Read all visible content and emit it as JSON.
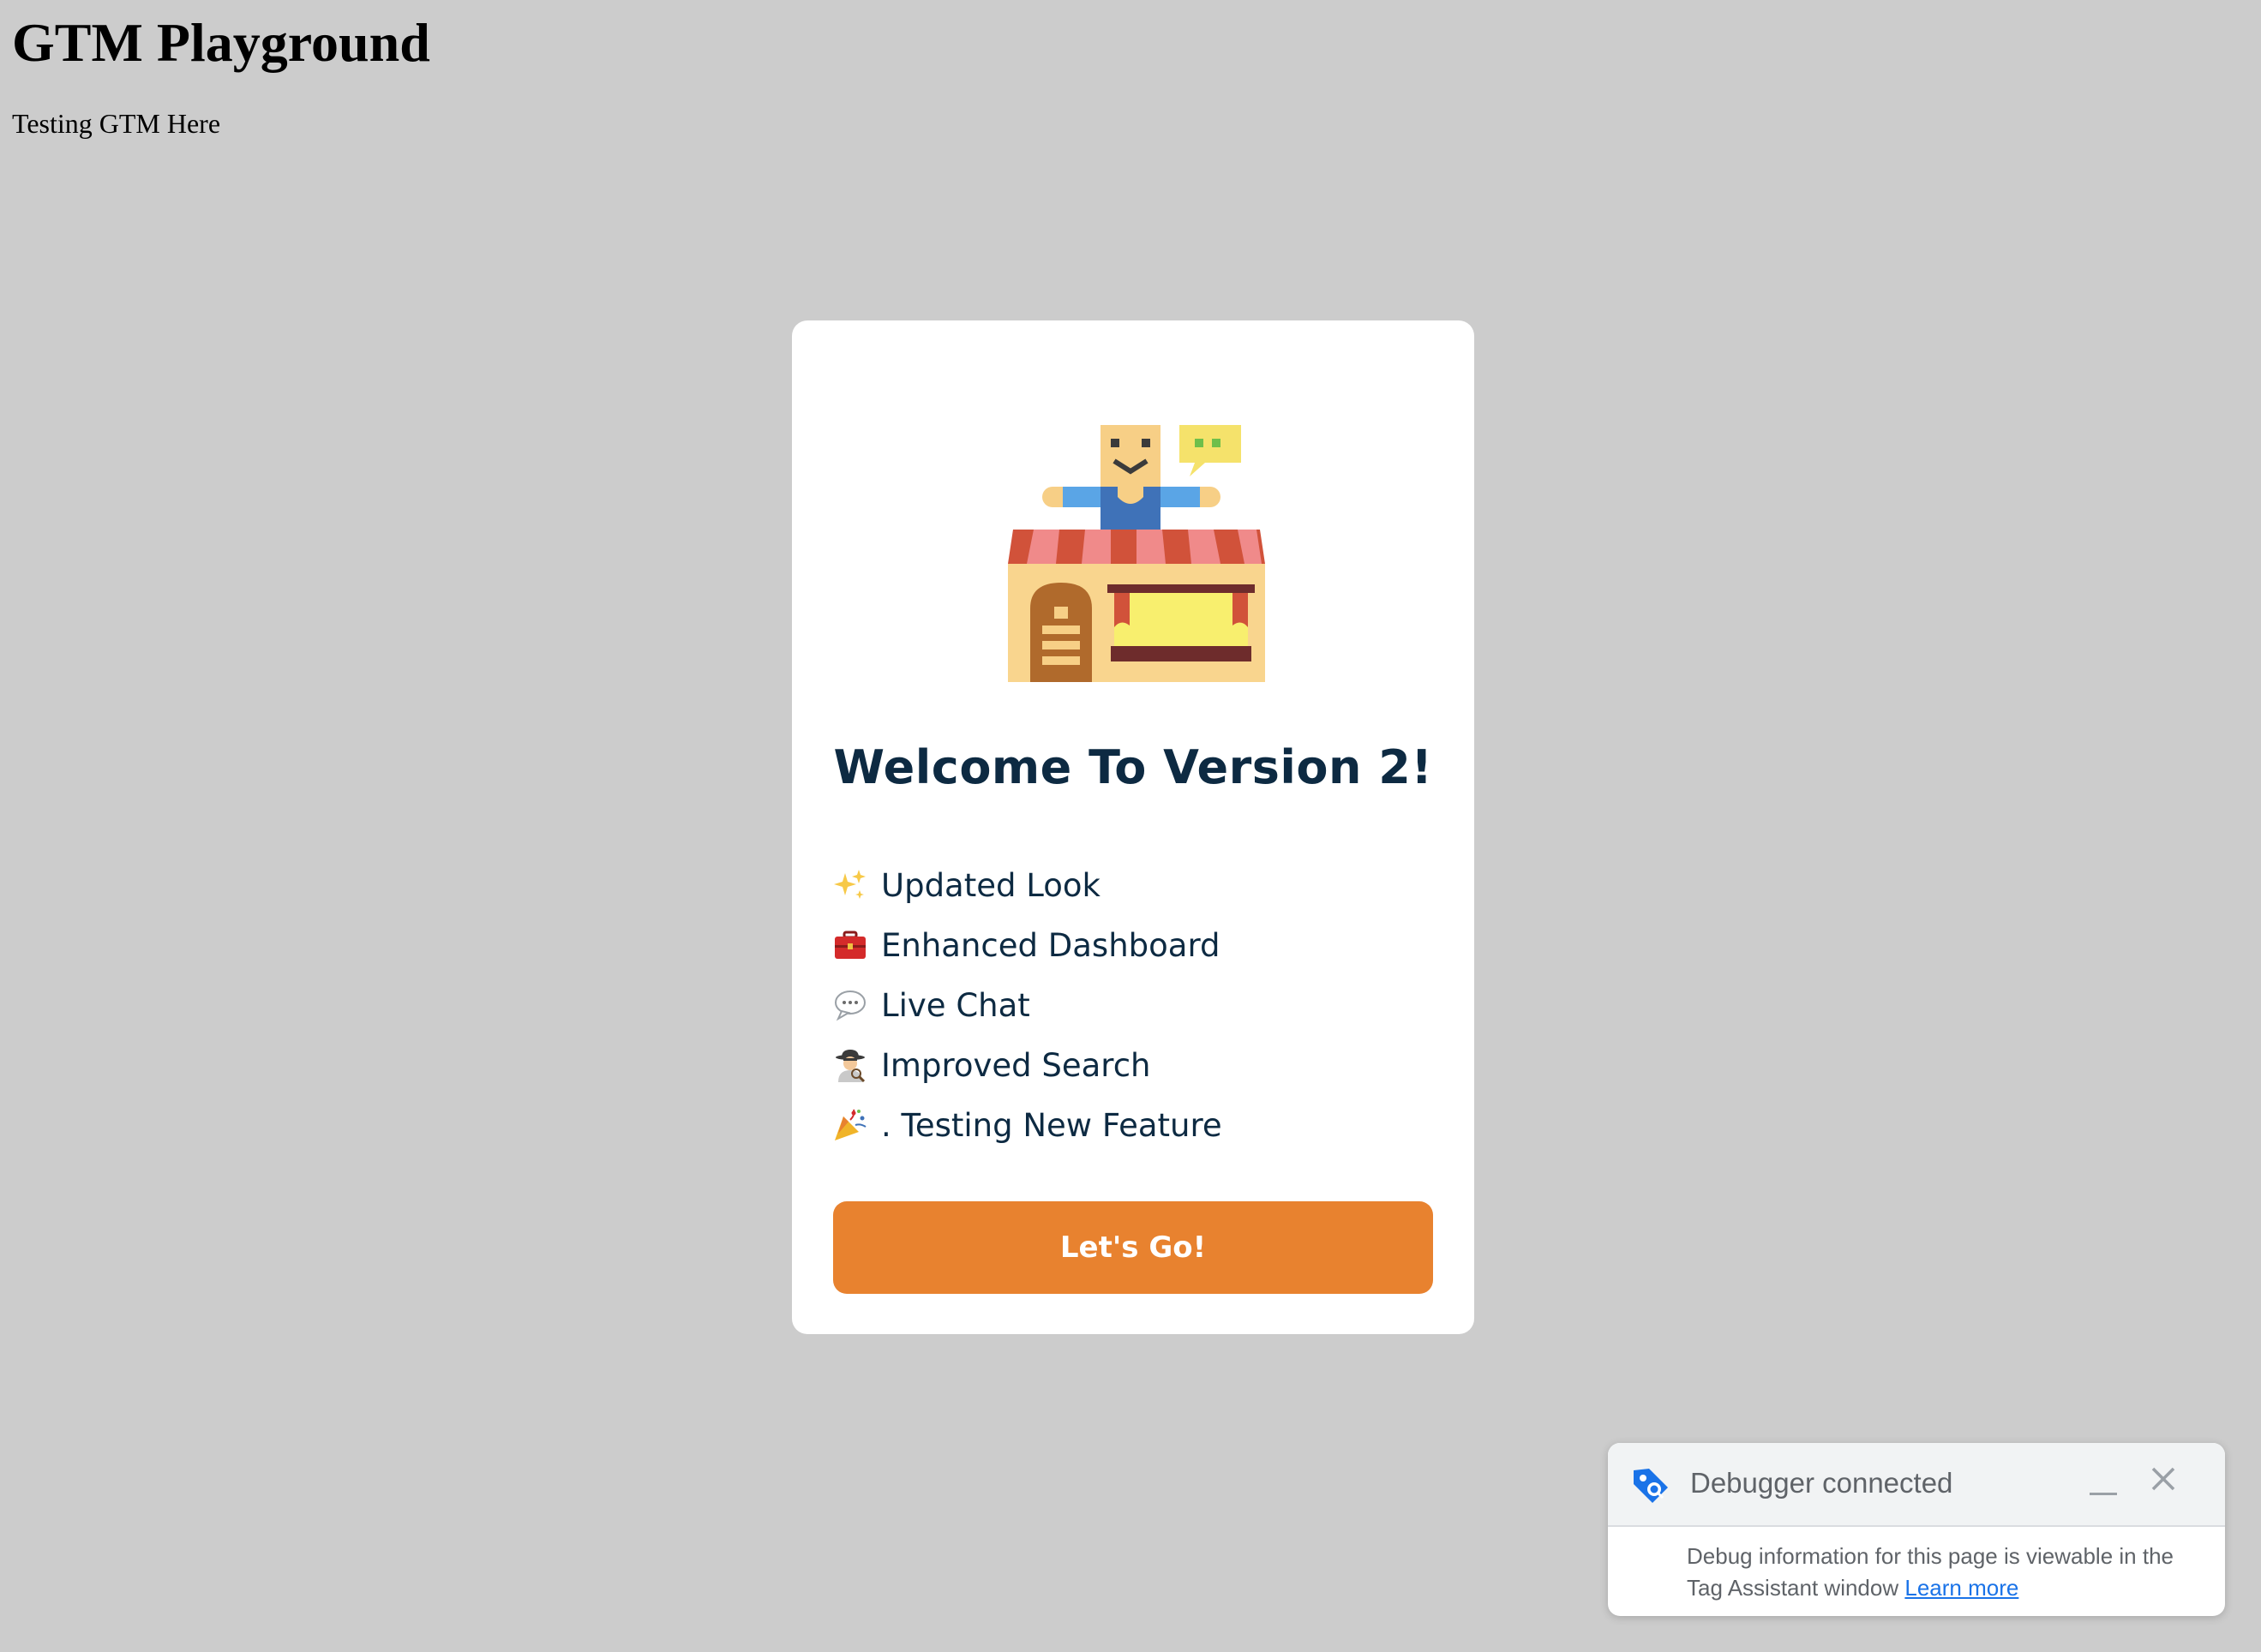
{
  "page": {
    "title": "GTM Playground",
    "subtitle": "Testing GTM Here"
  },
  "modal": {
    "illustration": "storefront-illustration",
    "title": "Welcome To Version 2!",
    "features": [
      {
        "icon": "sparkles-icon",
        "label": "Updated Look"
      },
      {
        "icon": "toolbox-icon",
        "label": "Enhanced Dashboard"
      },
      {
        "icon": "speech-bubble-icon",
        "label": "Live Chat"
      },
      {
        "icon": "detective-icon",
        "label": "Improved Search"
      },
      {
        "icon": "party-popper-icon",
        "label": ". Testing New Feature"
      }
    ],
    "cta_label": "Let's Go!",
    "cta_color": "#e8822f"
  },
  "debugger": {
    "title": "Debugger connected",
    "body": "Debug information for this page is viewable in the Tag Assistant window",
    "link_label": "Learn more",
    "accent": "#1a73e8"
  }
}
